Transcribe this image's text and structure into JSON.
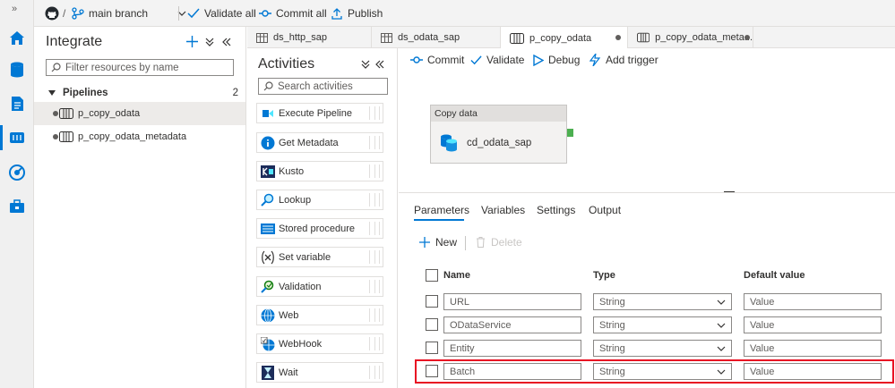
{
  "toolbar": {
    "branch_separator": "/",
    "branch": "main branch",
    "validate_all": "Validate all",
    "commit_all": "Commit all",
    "publish": "Publish"
  },
  "integrate": {
    "title": "Integrate",
    "filter_placeholder": "Filter resources by name",
    "section": "Pipelines",
    "count": "2",
    "items": [
      "p_copy_odata",
      "p_copy_odata_metadata"
    ]
  },
  "tabs": [
    {
      "label": "ds_http_sap"
    },
    {
      "label": "ds_odata_sap"
    },
    {
      "label": "p_copy_odata"
    },
    {
      "label": "p_copy_odata_meta..."
    }
  ],
  "activities": {
    "title": "Activities",
    "search_placeholder": "Search activities",
    "items": [
      "Execute Pipeline",
      "Get Metadata",
      "Kusto",
      "Lookup",
      "Stored procedure",
      "Set variable",
      "Validation",
      "Web",
      "WebHook",
      "Wait"
    ]
  },
  "canvas": {
    "commit": "Commit",
    "validate": "Validate",
    "debug": "Debug",
    "add_trigger": "Add trigger",
    "node_header": "Copy data",
    "node_name": "cd_odata_sap"
  },
  "props": {
    "tabs": [
      "Parameters",
      "Variables",
      "Settings",
      "Output"
    ],
    "new": "New",
    "delete": "Delete",
    "columns": {
      "name": "Name",
      "type": "Type",
      "default": "Default value"
    },
    "value_placeholder": "Value",
    "rows": [
      {
        "name": "URL",
        "type": "String"
      },
      {
        "name": "ODataService",
        "type": "String"
      },
      {
        "name": "Entity",
        "type": "String"
      },
      {
        "name": "Batch",
        "type": "String"
      }
    ]
  },
  "colors": {
    "accent": "#0078d4",
    "highlight": "#e81123"
  }
}
